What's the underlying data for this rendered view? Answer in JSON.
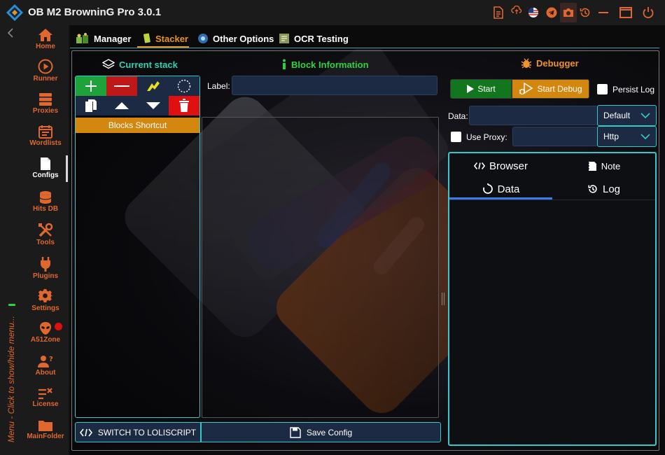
{
  "app": {
    "title": "OB M2 BrowninG Pro  3.0.1"
  },
  "sidebar": {
    "items": [
      {
        "label": "Home",
        "icon": "home-icon"
      },
      {
        "label": "Runner",
        "icon": "play-circle-icon"
      },
      {
        "label": "Proxies",
        "icon": "server-icon"
      },
      {
        "label": "Wordlists",
        "icon": "calendar-list-icon"
      },
      {
        "label": "Configs",
        "icon": "document-icon",
        "active": true
      },
      {
        "label": "Hits DB",
        "icon": "database-icon"
      },
      {
        "label": "Tools",
        "icon": "tools-icon"
      },
      {
        "label": "Plugins",
        "icon": "plug-icon"
      },
      {
        "label": "Settings",
        "icon": "gear-icon"
      },
      {
        "label": "A51Zone",
        "icon": "alien-icon"
      },
      {
        "label": "About",
        "icon": "user-question-icon"
      },
      {
        "label": "License",
        "icon": "license-icon"
      },
      {
        "label": "MainFolder",
        "icon": "folder-icon"
      }
    ],
    "menu_hint": "Menu - Click to show/hide menu..."
  },
  "tabs": [
    {
      "label": "Manager"
    },
    {
      "label": "Stacker",
      "active": true
    },
    {
      "label": "Other Options"
    },
    {
      "label": "OCR Testing"
    }
  ],
  "stacker": {
    "current_stack_label": "Current stack",
    "blocks_shortcut_label": "Blocks Shortcut",
    "switch_label": "SWITCH TO LOLISCRIPT",
    "save_label": "Save Config"
  },
  "block_info": {
    "header": "Block Information",
    "label_caption": "Label:",
    "label_value": ""
  },
  "debugger": {
    "header": "Debugger",
    "start_label": "Start",
    "start_debug_label": "Start Debug",
    "persist_log_label": "Persist Log",
    "data_caption": "Data:",
    "data_value": "",
    "data_type_selected": "Default",
    "use_proxy_label": "Use Proxy:",
    "proxy_value": "",
    "proxy_type_selected": "Http",
    "tabs": {
      "browser": "Browser",
      "note": "Note",
      "data": "Data",
      "log": "Log"
    }
  },
  "colors": {
    "accent_orange": "#e0672d",
    "tab_orange": "#e8941a",
    "teal_border": "#33c9c9",
    "green_header": "#2ed23a",
    "debugger_orange": "#f0922a",
    "start_green": "#12761e",
    "add_green": "#1ea33a",
    "remove_red": "#c01818",
    "delete_red": "#e01010",
    "field_blue": "#1c2a44",
    "active_tab_blue": "#3b7cf0"
  }
}
